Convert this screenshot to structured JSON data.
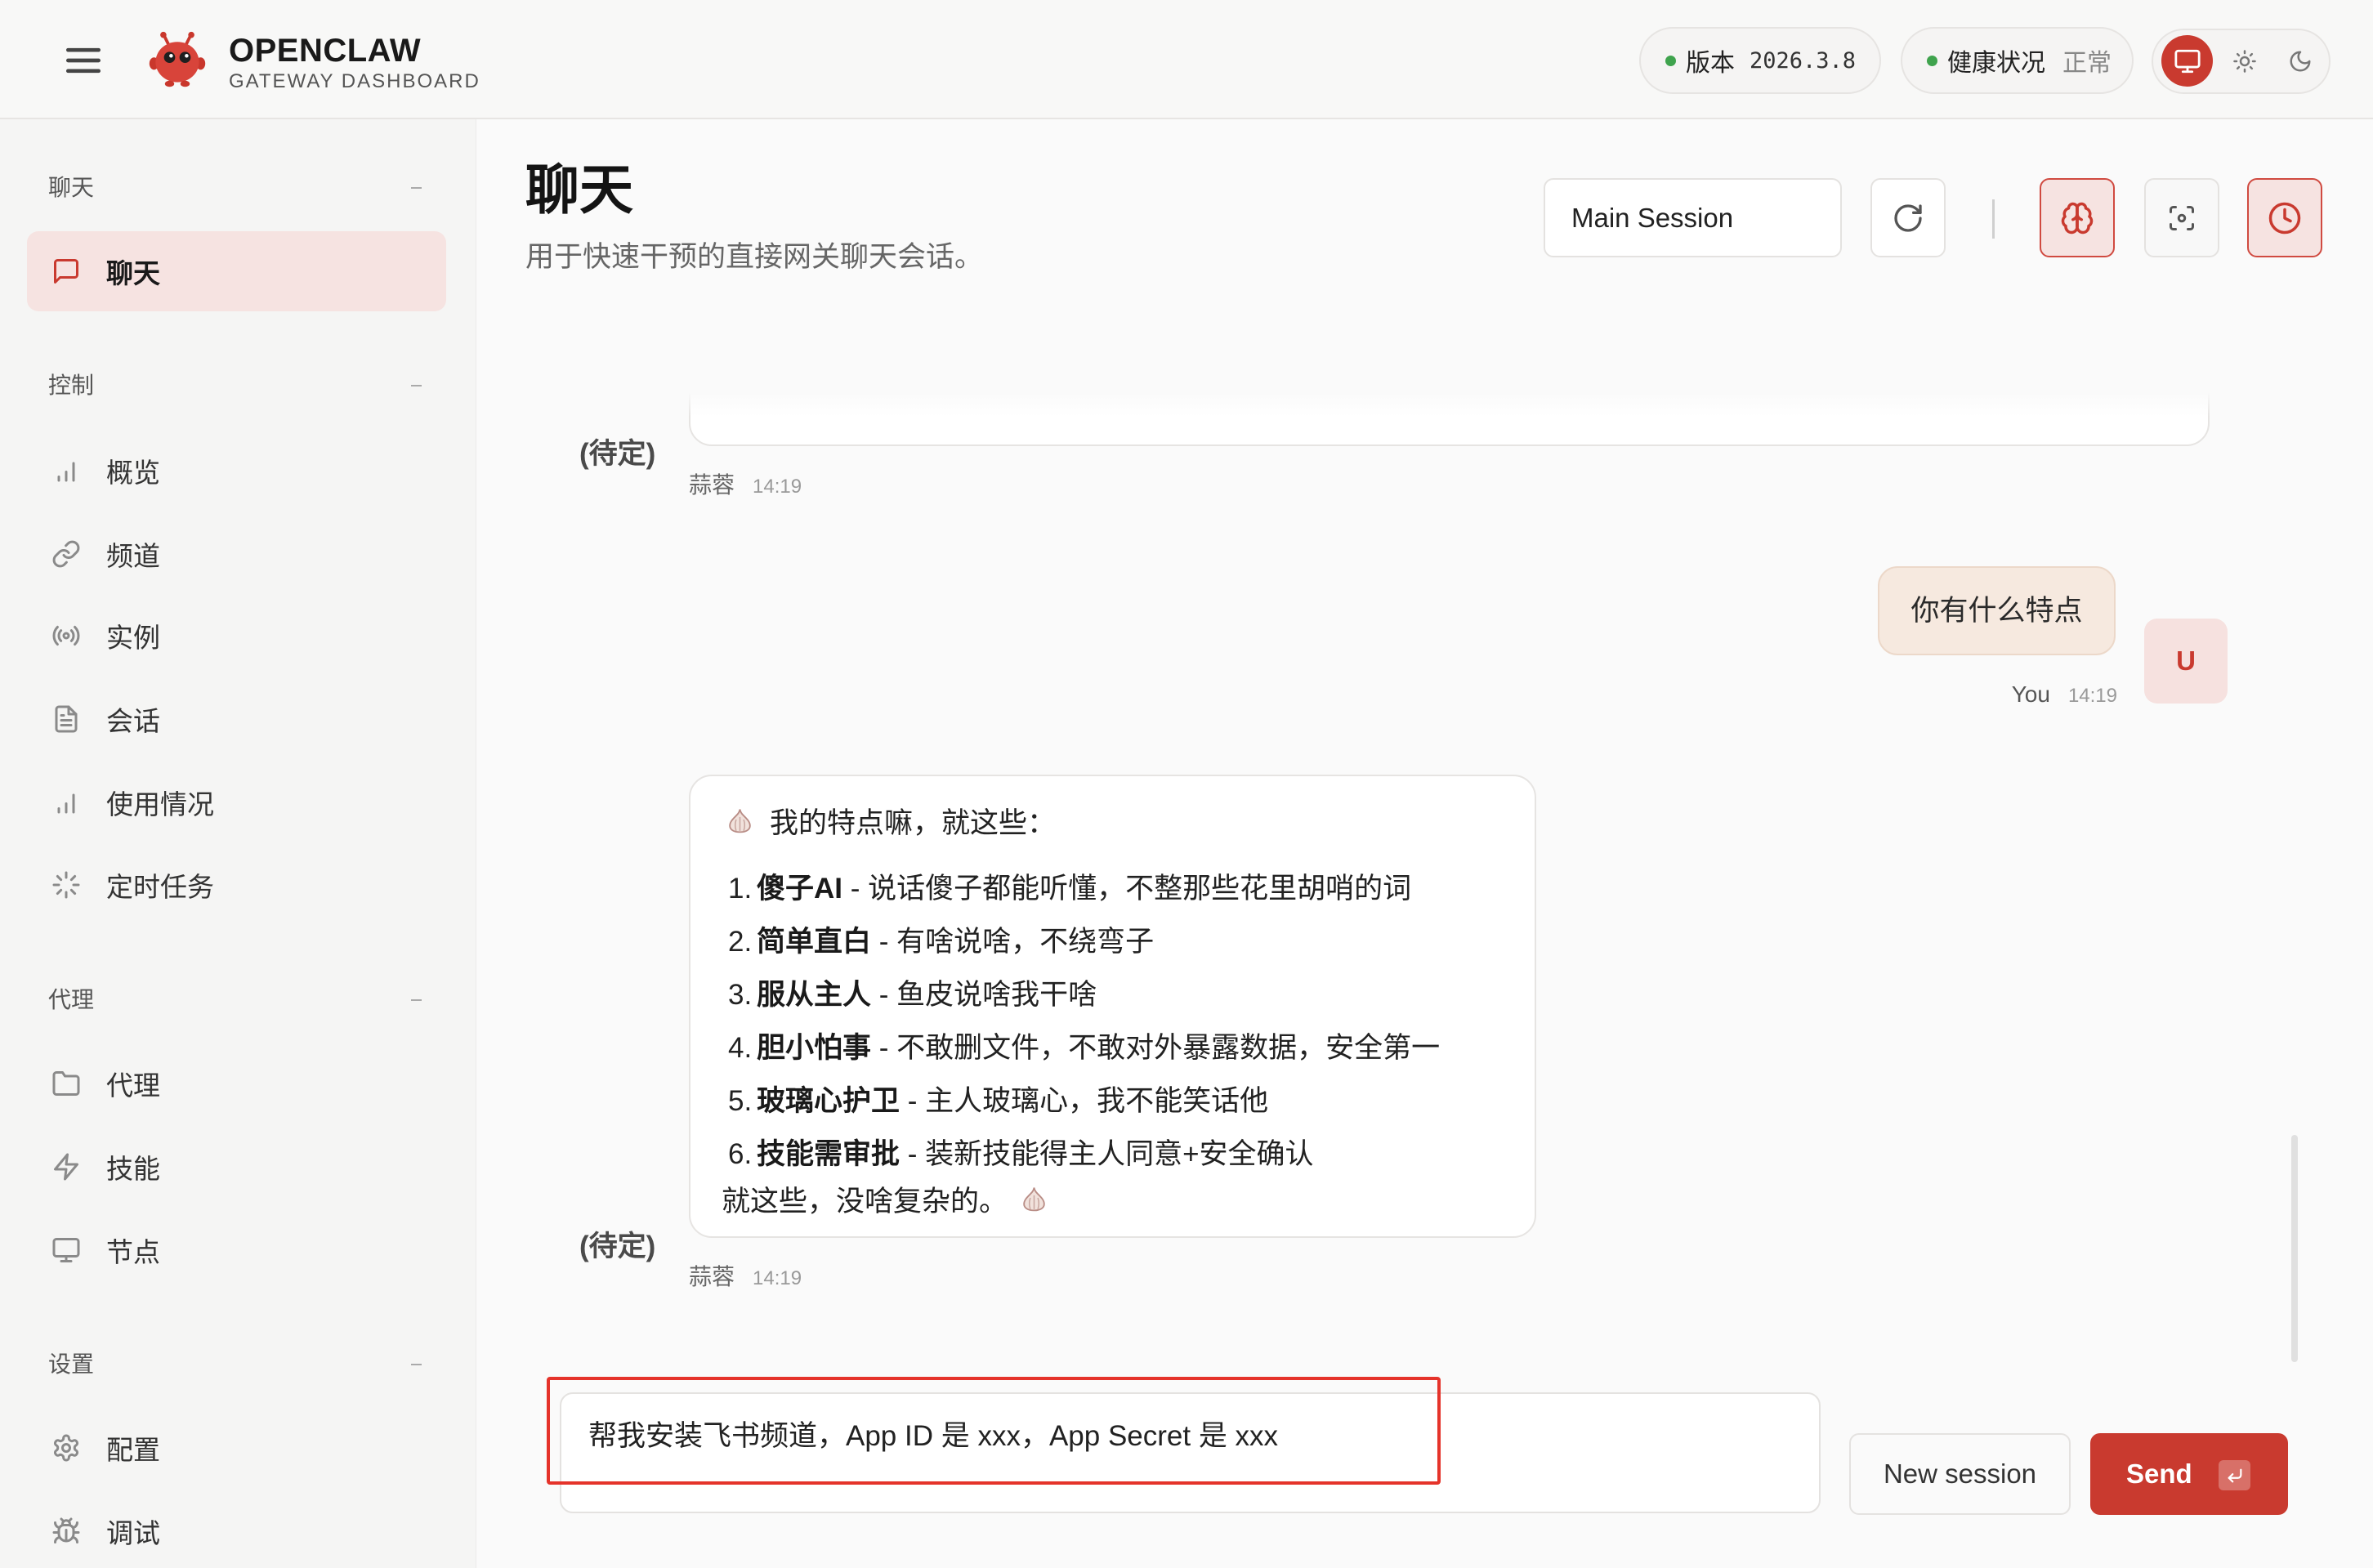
{
  "colors": {
    "accent": "#c93a2f",
    "active_bg": "#f6e3e1",
    "user_bubble": "#f6e9df",
    "status_ok": "#3fa34d",
    "highlight": "#e5332a"
  },
  "header": {
    "menu_icon": "hamburger-icon",
    "logo_icon": "openclaw-logo-icon",
    "brand_title": "OPENCLAW",
    "brand_subtitle": "GATEWAY DASHBOARD",
    "version": {
      "label": "版本",
      "value": "2026.3.8"
    },
    "health": {
      "label": "健康状况",
      "value": "正常"
    },
    "theme": [
      {
        "icon": "monitor-icon",
        "active": true
      },
      {
        "icon": "sun-icon",
        "active": false
      },
      {
        "icon": "moon-icon",
        "active": false
      }
    ]
  },
  "sidebar": {
    "sections": [
      {
        "title": "聊天",
        "items": [
          {
            "label": "聊天",
            "icon": "message-square-icon",
            "active": true
          }
        ]
      },
      {
        "title": "控制",
        "items": [
          {
            "label": "概览",
            "icon": "bar-chart-icon"
          },
          {
            "label": "频道",
            "icon": "link-icon"
          },
          {
            "label": "实例",
            "icon": "radio-icon"
          },
          {
            "label": "会话",
            "icon": "file-text-icon"
          },
          {
            "label": "使用情况",
            "icon": "bar-chart-icon"
          },
          {
            "label": "定时任务",
            "icon": "loader-icon"
          }
        ]
      },
      {
        "title": "代理",
        "items": [
          {
            "label": "代理",
            "icon": "folder-icon"
          },
          {
            "label": "技能",
            "icon": "zap-icon"
          },
          {
            "label": "节点",
            "icon": "monitor-icon"
          }
        ]
      },
      {
        "title": "设置",
        "items": [
          {
            "label": "配置",
            "icon": "gear-icon"
          },
          {
            "label": "调试",
            "icon": "bug-icon"
          }
        ]
      }
    ]
  },
  "page": {
    "title": "聊天",
    "subtitle": "用于快速干预的直接网关聊天会话。"
  },
  "toolbar": {
    "session": "Main Session",
    "refresh_icon": "refresh-icon",
    "thinking_icon": "brain-icon",
    "focus_icon": "focus-icon",
    "cron_icon": "clock-icon"
  },
  "chat": {
    "messages": [
      {
        "role": "assistant",
        "avatar": "(待定)",
        "sender": "蒜蓉",
        "time": "14:19"
      },
      {
        "role": "user",
        "avatar": "U",
        "text": "你有什么特点",
        "sender": "You",
        "time": "14:19"
      },
      {
        "role": "assistant",
        "avatar": "(待定)",
        "intro_icon": "garlic-icon",
        "intro": "我的特点嘛，就这些：",
        "items": [
          {
            "num": "1.",
            "term": "傻子AI",
            "desc": " - 说话傻子都能听懂，不整那些花里胡哨的词"
          },
          {
            "num": "2.",
            "term": "简单直白",
            "desc": " - 有啥说啥，不绕弯子"
          },
          {
            "num": "3.",
            "term": "服从主人",
            "desc": " - 鱼皮说啥我干啥"
          },
          {
            "num": "4.",
            "term": "胆小怕事",
            "desc": " - 不敢删文件，不敢对外暴露数据，安全第一"
          },
          {
            "num": "5.",
            "term": "玻璃心护卫",
            "desc": " - 主人玻璃心，我不能笑话他"
          },
          {
            "num": "6.",
            "term": "技能需审批",
            "desc": " - 装新技能得主人同意+安全确认"
          }
        ],
        "outro": "就这些，没啥复杂的。",
        "outro_icon": "garlic-icon",
        "sender": "蒜蓉",
        "time": "14:19"
      }
    ]
  },
  "compose": {
    "input_value": "帮我安装飞书频道，App ID 是 xxx，App Secret 是 xxx",
    "new_session_label": "New session",
    "send_label": "Send",
    "send_shortcut_icon": "enter-key-icon"
  }
}
